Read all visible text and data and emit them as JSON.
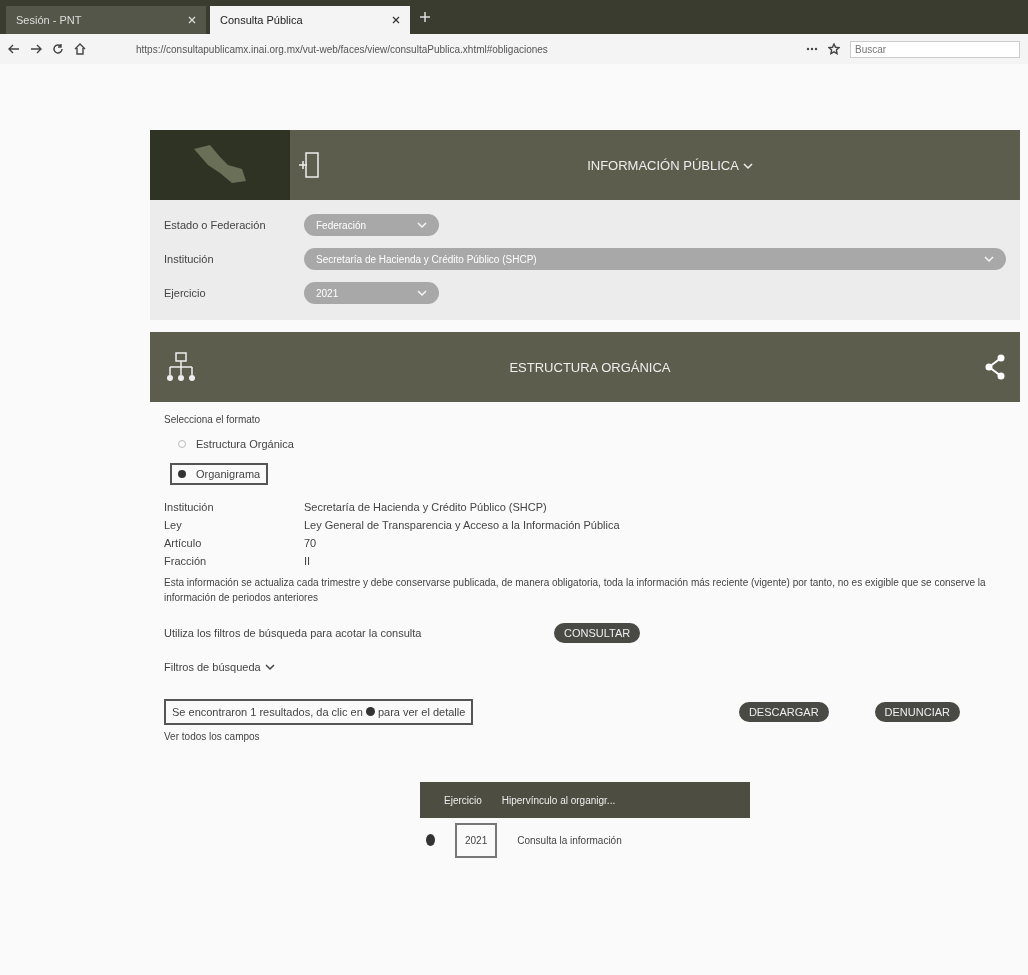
{
  "browser": {
    "tabs": [
      {
        "label": "Sesión - PNT",
        "selected": false
      },
      {
        "label": "Consulta Pública",
        "selected": true
      }
    ],
    "url": "https://consultapublicamx.inai.org.mx/vut-web/faces/view/consultaPublica.xhtml#obligaciones",
    "search": {
      "placeholder": "Buscar"
    }
  },
  "header": {
    "title": "INFORMACIÓN PÚBLICA"
  },
  "filters": [
    {
      "label": "Estado o Federación",
      "value": "Federación",
      "wide": false
    },
    {
      "label": "Institución",
      "value": "Secretaría de Hacienda y Crédito Público (SHCP)",
      "wide": true
    },
    {
      "label": "Ejercicio",
      "value": "2021",
      "wide": false
    }
  ],
  "section": {
    "title": "ESTRUCTURA ORGÁNICA"
  },
  "format": {
    "prompt": "Selecciona el formato",
    "options": [
      {
        "label": "Estructura Orgánica",
        "selected": false
      },
      {
        "label": "Organigrama",
        "selected": true
      }
    ]
  },
  "details": [
    {
      "label": "Institución",
      "value": "Secretaría de Hacienda y Crédito Público (SHCP)"
    },
    {
      "label": "Ley",
      "value": "Ley General de Transparencia y Acceso a la Información Pública"
    },
    {
      "label": "Artículo",
      "value": "70"
    },
    {
      "label": "Fracción",
      "value": "II"
    }
  ],
  "note": "Esta información se actualiza cada trimestre y debe conservarse publicada, de manera obligatoria, toda la información más reciente (vigente) por tanto, no es exigible que se conserve la información de periodos anteriores",
  "query": {
    "text": "Utiliza los filtros de búsqueda para acotar la consulta",
    "button": "CONSULTAR"
  },
  "filters_toggle": "Filtros de búsqueda",
  "results": {
    "text": "Se encontraron 1 resultados, da clic en",
    "text_after": "para ver el detalle",
    "buttons": [
      "DESCARGAR",
      "DENUNCIAR"
    ],
    "show_all": "Ver todos los campos"
  },
  "table": {
    "columns": [
      "Ejercicio",
      "Hipervínculo al organigr..."
    ],
    "rows": [
      [
        "2021",
        "Consulta la información"
      ]
    ]
  }
}
